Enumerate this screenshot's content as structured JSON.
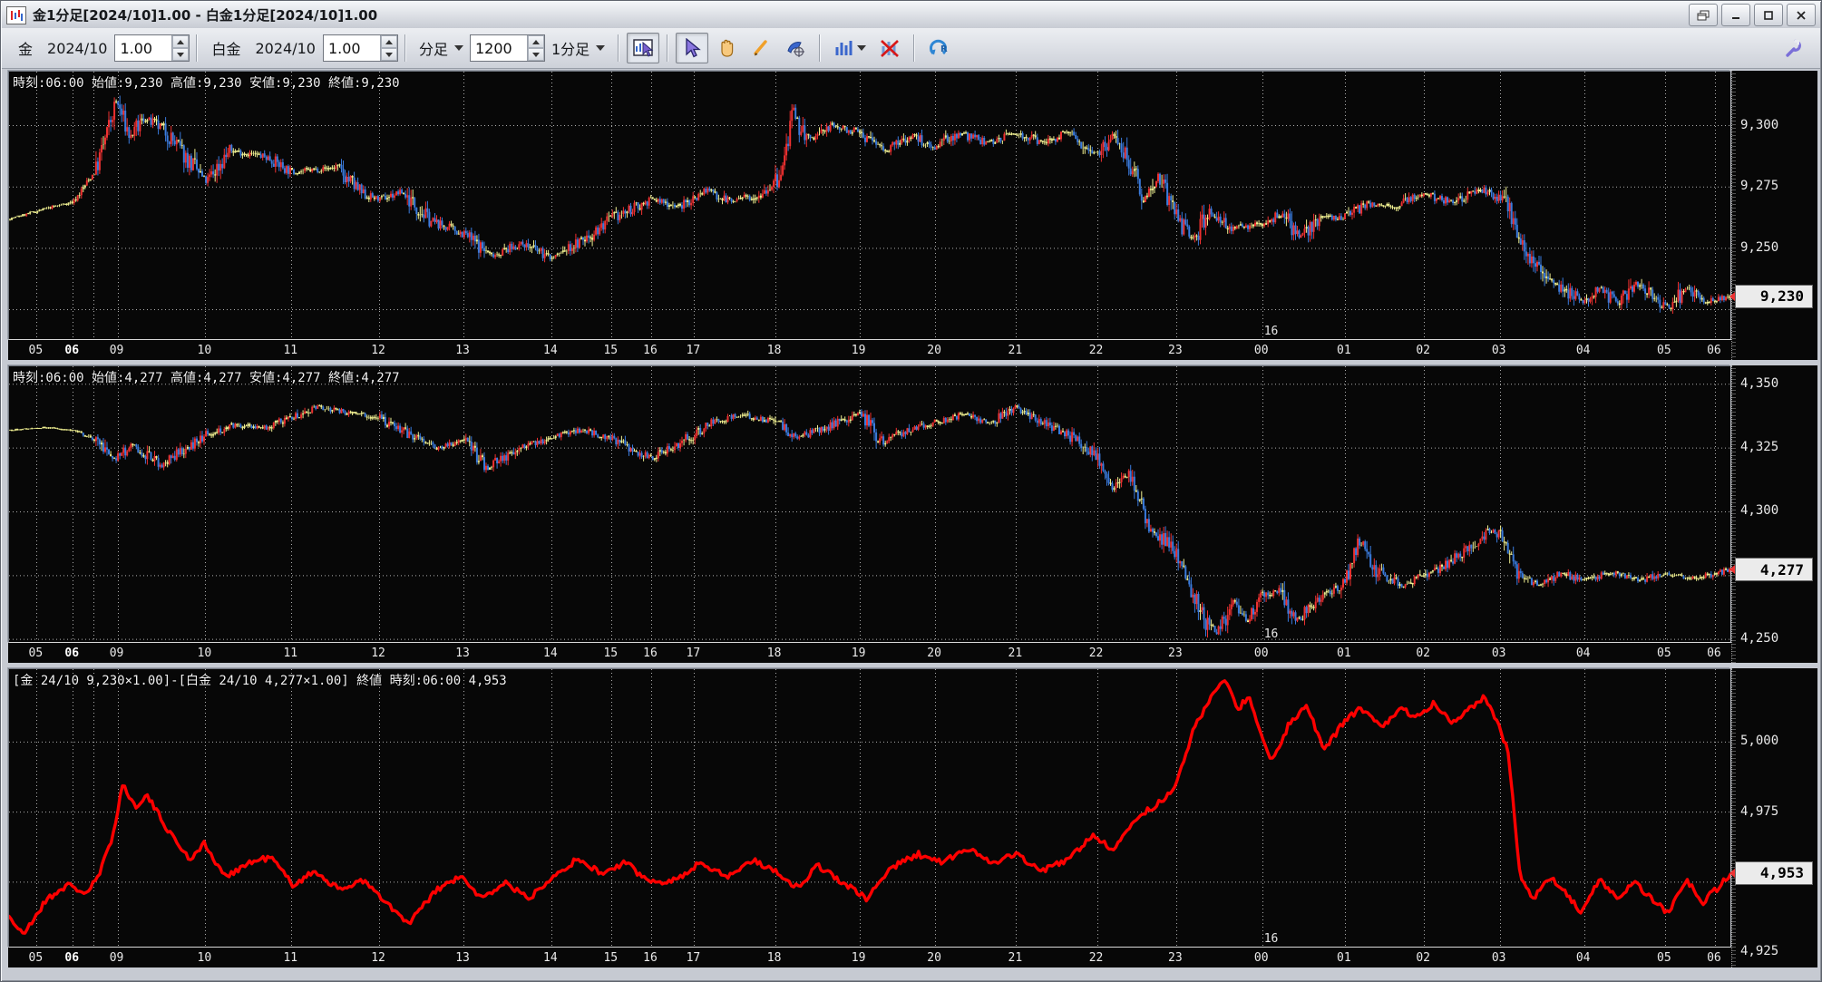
{
  "window": {
    "title": "金1分足[2024/10]1.00 - 白金1分足[2024/10]1.00"
  },
  "toolbar": {
    "gold_label": "金",
    "gold_contract": "2024/10",
    "gold_multiplier": "1.00",
    "platinum_label": "白金",
    "platinum_contract": "2024/10",
    "platinum_multiplier": "1.00",
    "period_type": "分足",
    "bar_count": "1200",
    "interval": "1分足"
  },
  "x_axis": {
    "ticks": [
      {
        "label": "05",
        "pos": 0.016
      },
      {
        "label": "06",
        "pos": 0.037,
        "bold": true
      },
      {
        "label": "09",
        "pos": 0.063
      },
      {
        "label": "10",
        "pos": 0.114
      },
      {
        "label": "11",
        "pos": 0.164
      },
      {
        "label": "12",
        "pos": 0.215
      },
      {
        "label": "13",
        "pos": 0.264
      },
      {
        "label": "14",
        "pos": 0.315
      },
      {
        "label": "15",
        "pos": 0.35
      },
      {
        "label": "16",
        "pos": 0.373
      },
      {
        "label": "17",
        "pos": 0.398
      },
      {
        "label": "18",
        "pos": 0.445
      },
      {
        "label": "19",
        "pos": 0.494
      },
      {
        "label": "20",
        "pos": 0.538
      },
      {
        "label": "21",
        "pos": 0.585
      },
      {
        "label": "22",
        "pos": 0.632
      },
      {
        "label": "23",
        "pos": 0.678
      },
      {
        "label": "00",
        "pos": 0.728
      },
      {
        "label": "01",
        "pos": 0.776
      },
      {
        "label": "02",
        "pos": 0.822
      },
      {
        "label": "03",
        "pos": 0.866
      },
      {
        "label": "04",
        "pos": 0.915
      },
      {
        "label": "05",
        "pos": 0.962
      },
      {
        "label": "06",
        "pos": 0.991
      }
    ],
    "session_lines": [
      0.049
    ],
    "date_label": "16",
    "date_label_pos": 0.728
  },
  "style": {
    "grid_color": "#c0c0c0",
    "candle_up": "#ee3030",
    "candle_down": "#3a7bdd",
    "candle_doji": "#eeee90",
    "spread_line": "#ff0000",
    "plot_bg": "#070707"
  },
  "chart_data": [
    {
      "type": "candlestick",
      "name": "gold-1min",
      "info": "時刻:06:00 始値:9,230 高値:9,230 安値:9,230 終値:9,230",
      "y_range": [
        9213,
        9322
      ],
      "y_gridlines": [
        9225,
        9250,
        9275,
        9300
      ],
      "y_labels": [
        {
          "v": 9300,
          "label": "9,300"
        },
        {
          "v": 9275,
          "label": "9,275"
        },
        {
          "v": 9250,
          "label": "9,250"
        }
      ],
      "current": {
        "v": 9230,
        "label": "9,230"
      },
      "bars": 940,
      "seed": 7,
      "vol": 3.1,
      "doji": 0.85,
      "calm_until": 0.049,
      "keyframes": [
        [
          0,
          9262
        ],
        [
          0.02,
          9266
        ],
        [
          0.037,
          9269
        ],
        [
          0.05,
          9282
        ],
        [
          0.062,
          9310
        ],
        [
          0.07,
          9295
        ],
        [
          0.078,
          9303
        ],
        [
          0.09,
          9298
        ],
        [
          0.114,
          9277
        ],
        [
          0.128,
          9290
        ],
        [
          0.15,
          9287
        ],
        [
          0.164,
          9281
        ],
        [
          0.19,
          9283
        ],
        [
          0.205,
          9272
        ],
        [
          0.215,
          9270
        ],
        [
          0.228,
          9273
        ],
        [
          0.245,
          9261
        ],
        [
          0.264,
          9256
        ],
        [
          0.28,
          9247
        ],
        [
          0.298,
          9252
        ],
        [
          0.315,
          9246
        ],
        [
          0.335,
          9254
        ],
        [
          0.35,
          9262
        ],
        [
          0.362,
          9266
        ],
        [
          0.373,
          9270
        ],
        [
          0.39,
          9267
        ],
        [
          0.405,
          9274
        ],
        [
          0.42,
          9269
        ],
        [
          0.435,
          9272
        ],
        [
          0.448,
          9278
        ],
        [
          0.455,
          9304
        ],
        [
          0.465,
          9294
        ],
        [
          0.478,
          9300
        ],
        [
          0.494,
          9297
        ],
        [
          0.51,
          9290
        ],
        [
          0.525,
          9296
        ],
        [
          0.538,
          9291
        ],
        [
          0.552,
          9297
        ],
        [
          0.568,
          9293
        ],
        [
          0.585,
          9297
        ],
        [
          0.6,
          9293
        ],
        [
          0.615,
          9297
        ],
        [
          0.632,
          9289
        ],
        [
          0.643,
          9297
        ],
        [
          0.652,
          9284
        ],
        [
          0.66,
          9270
        ],
        [
          0.668,
          9280
        ],
        [
          0.678,
          9262
        ],
        [
          0.688,
          9254
        ],
        [
          0.698,
          9265
        ],
        [
          0.71,
          9258
        ],
        [
          0.728,
          9260
        ],
        [
          0.74,
          9264
        ],
        [
          0.75,
          9255
        ],
        [
          0.762,
          9262
        ],
        [
          0.776,
          9263
        ],
        [
          0.79,
          9268
        ],
        [
          0.805,
          9267
        ],
        [
          0.822,
          9272
        ],
        [
          0.838,
          9269
        ],
        [
          0.855,
          9274
        ],
        [
          0.866,
          9271
        ],
        [
          0.872,
          9266
        ],
        [
          0.882,
          9249
        ],
        [
          0.895,
          9238
        ],
        [
          0.905,
          9233
        ],
        [
          0.915,
          9227
        ],
        [
          0.925,
          9234
        ],
        [
          0.935,
          9227
        ],
        [
          0.945,
          9236
        ],
        [
          0.955,
          9230
        ],
        [
          0.965,
          9226
        ],
        [
          0.975,
          9234
        ],
        [
          0.985,
          9228
        ],
        [
          1,
          9230
        ]
      ]
    },
    {
      "type": "candlestick",
      "name": "platinum-1min",
      "info": "時刻:06:00 始値:4,277 高値:4,277 安値:4,277 終値:4,277",
      "y_range": [
        4249,
        4357
      ],
      "y_gridlines": [
        4250,
        4275,
        4300,
        4325,
        4350
      ],
      "y_labels": [
        {
          "v": 4350,
          "label": "4,350"
        },
        {
          "v": 4325,
          "label": "4,325"
        },
        {
          "v": 4300,
          "label": "4,300"
        },
        {
          "v": 4250,
          "label": "4,250"
        }
      ],
      "current": {
        "v": 4277,
        "label": "4,277"
      },
      "bars": 940,
      "seed": 13,
      "vol": 2.6,
      "doji": 0.75,
      "calm_until": 0.049,
      "keyframes": [
        [
          0,
          4332
        ],
        [
          0.02,
          4333
        ],
        [
          0.037,
          4332
        ],
        [
          0.05,
          4328
        ],
        [
          0.06,
          4320
        ],
        [
          0.072,
          4326
        ],
        [
          0.088,
          4318
        ],
        [
          0.1,
          4324
        ],
        [
          0.114,
          4330
        ],
        [
          0.13,
          4334
        ],
        [
          0.148,
          4333
        ],
        [
          0.164,
          4337
        ],
        [
          0.178,
          4341
        ],
        [
          0.195,
          4339
        ],
        [
          0.215,
          4337
        ],
        [
          0.232,
          4330
        ],
        [
          0.248,
          4325
        ],
        [
          0.264,
          4328
        ],
        [
          0.278,
          4317
        ],
        [
          0.295,
          4325
        ],
        [
          0.315,
          4329
        ],
        [
          0.332,
          4332
        ],
        [
          0.35,
          4329
        ],
        [
          0.36,
          4325
        ],
        [
          0.373,
          4321
        ],
        [
          0.39,
          4327
        ],
        [
          0.408,
          4335
        ],
        [
          0.425,
          4338
        ],
        [
          0.445,
          4335
        ],
        [
          0.458,
          4329
        ],
        [
          0.475,
          4333
        ],
        [
          0.494,
          4339
        ],
        [
          0.508,
          4327
        ],
        [
          0.525,
          4333
        ],
        [
          0.538,
          4335
        ],
        [
          0.555,
          4338
        ],
        [
          0.57,
          4335
        ],
        [
          0.585,
          4341
        ],
        [
          0.602,
          4335
        ],
        [
          0.618,
          4329
        ],
        [
          0.632,
          4321
        ],
        [
          0.64,
          4309
        ],
        [
          0.65,
          4315
        ],
        [
          0.662,
          4296
        ],
        [
          0.678,
          4283
        ],
        [
          0.687,
          4269
        ],
        [
          0.695,
          4257
        ],
        [
          0.702,
          4252
        ],
        [
          0.712,
          4265
        ],
        [
          0.72,
          4257
        ],
        [
          0.728,
          4267
        ],
        [
          0.738,
          4270
        ],
        [
          0.748,
          4257
        ],
        [
          0.76,
          4265
        ],
        [
          0.776,
          4271
        ],
        [
          0.784,
          4289
        ],
        [
          0.795,
          4277
        ],
        [
          0.81,
          4271
        ],
        [
          0.822,
          4275
        ],
        [
          0.835,
          4279
        ],
        [
          0.85,
          4287
        ],
        [
          0.862,
          4293
        ],
        [
          0.868,
          4290
        ],
        [
          0.876,
          4275
        ],
        [
          0.89,
          4271
        ],
        [
          0.902,
          4276
        ],
        [
          0.915,
          4273
        ],
        [
          0.93,
          4276
        ],
        [
          0.948,
          4273
        ],
        [
          0.962,
          4276
        ],
        [
          0.98,
          4274
        ],
        [
          1,
          4277
        ]
      ]
    },
    {
      "type": "line",
      "name": "spread-gold-minus-platinum",
      "info": "[金 24/10 9,230×1.00]-[白金 24/10 4,277×1.00] 終値 時刻:06:00 4,953",
      "y_range": [
        4927,
        5026
      ],
      "y_gridlines": [
        4950,
        4975,
        5000
      ],
      "y_labels": [
        {
          "v": 5000,
          "label": "5,000"
        },
        {
          "v": 4975,
          "label": "4,975"
        },
        {
          "v": 4925,
          "label": "4,925"
        }
      ],
      "current": {
        "v": 4953,
        "label": "4,953"
      },
      "points": 760,
      "seed": 21,
      "jitter": 2.2,
      "line_width": 3.4,
      "keyframes": [
        [
          0,
          4938
        ],
        [
          0.008,
          4931
        ],
        [
          0.022,
          4944
        ],
        [
          0.034,
          4949
        ],
        [
          0.045,
          4946
        ],
        [
          0.052,
          4952
        ],
        [
          0.06,
          4966
        ],
        [
          0.066,
          4985
        ],
        [
          0.073,
          4977
        ],
        [
          0.08,
          4981
        ],
        [
          0.093,
          4968
        ],
        [
          0.105,
          4958
        ],
        [
          0.113,
          4964
        ],
        [
          0.125,
          4952
        ],
        [
          0.14,
          4957
        ],
        [
          0.152,
          4959
        ],
        [
          0.165,
          4949
        ],
        [
          0.178,
          4954
        ],
        [
          0.192,
          4947
        ],
        [
          0.205,
          4951
        ],
        [
          0.22,
          4942
        ],
        [
          0.232,
          4935
        ],
        [
          0.248,
          4947
        ],
        [
          0.262,
          4952
        ],
        [
          0.275,
          4944
        ],
        [
          0.288,
          4950
        ],
        [
          0.302,
          4944
        ],
        [
          0.315,
          4952
        ],
        [
          0.33,
          4958
        ],
        [
          0.345,
          4953
        ],
        [
          0.358,
          4957
        ],
        [
          0.372,
          4950
        ],
        [
          0.388,
          4951
        ],
        [
          0.402,
          4957
        ],
        [
          0.418,
          4952
        ],
        [
          0.432,
          4958
        ],
        [
          0.445,
          4954
        ],
        [
          0.458,
          4948
        ],
        [
          0.47,
          4956
        ],
        [
          0.484,
          4950
        ],
        [
          0.498,
          4944
        ],
        [
          0.512,
          4955
        ],
        [
          0.528,
          4960
        ],
        [
          0.542,
          4957
        ],
        [
          0.558,
          4962
        ],
        [
          0.572,
          4957
        ],
        [
          0.585,
          4960
        ],
        [
          0.6,
          4954
        ],
        [
          0.615,
          4958
        ],
        [
          0.63,
          4967
        ],
        [
          0.642,
          4961
        ],
        [
          0.653,
          4972
        ],
        [
          0.665,
          4977
        ],
        [
          0.676,
          4982
        ],
        [
          0.688,
          5004
        ],
        [
          0.698,
          5016
        ],
        [
          0.706,
          5023
        ],
        [
          0.714,
          5011
        ],
        [
          0.72,
          5017
        ],
        [
          0.728,
          5001
        ],
        [
          0.734,
          4993
        ],
        [
          0.744,
          5007
        ],
        [
          0.754,
          5013
        ],
        [
          0.764,
          4997
        ],
        [
          0.775,
          5007
        ],
        [
          0.785,
          5012
        ],
        [
          0.798,
          5005
        ],
        [
          0.808,
          5012
        ],
        [
          0.818,
          5009
        ],
        [
          0.828,
          5014
        ],
        [
          0.838,
          5007
        ],
        [
          0.848,
          5012
        ],
        [
          0.857,
          5016
        ],
        [
          0.865,
          5007
        ],
        [
          0.871,
          4996
        ],
        [
          0.878,
          4951
        ],
        [
          0.885,
          4944
        ],
        [
          0.895,
          4952
        ],
        [
          0.905,
          4946
        ],
        [
          0.913,
          4939
        ],
        [
          0.924,
          4951
        ],
        [
          0.934,
          4944
        ],
        [
          0.944,
          4950
        ],
        [
          0.954,
          4944
        ],
        [
          0.964,
          4939
        ],
        [
          0.974,
          4951
        ],
        [
          0.984,
          4943
        ],
        [
          0.993,
          4948
        ],
        [
          1,
          4953
        ]
      ]
    }
  ]
}
